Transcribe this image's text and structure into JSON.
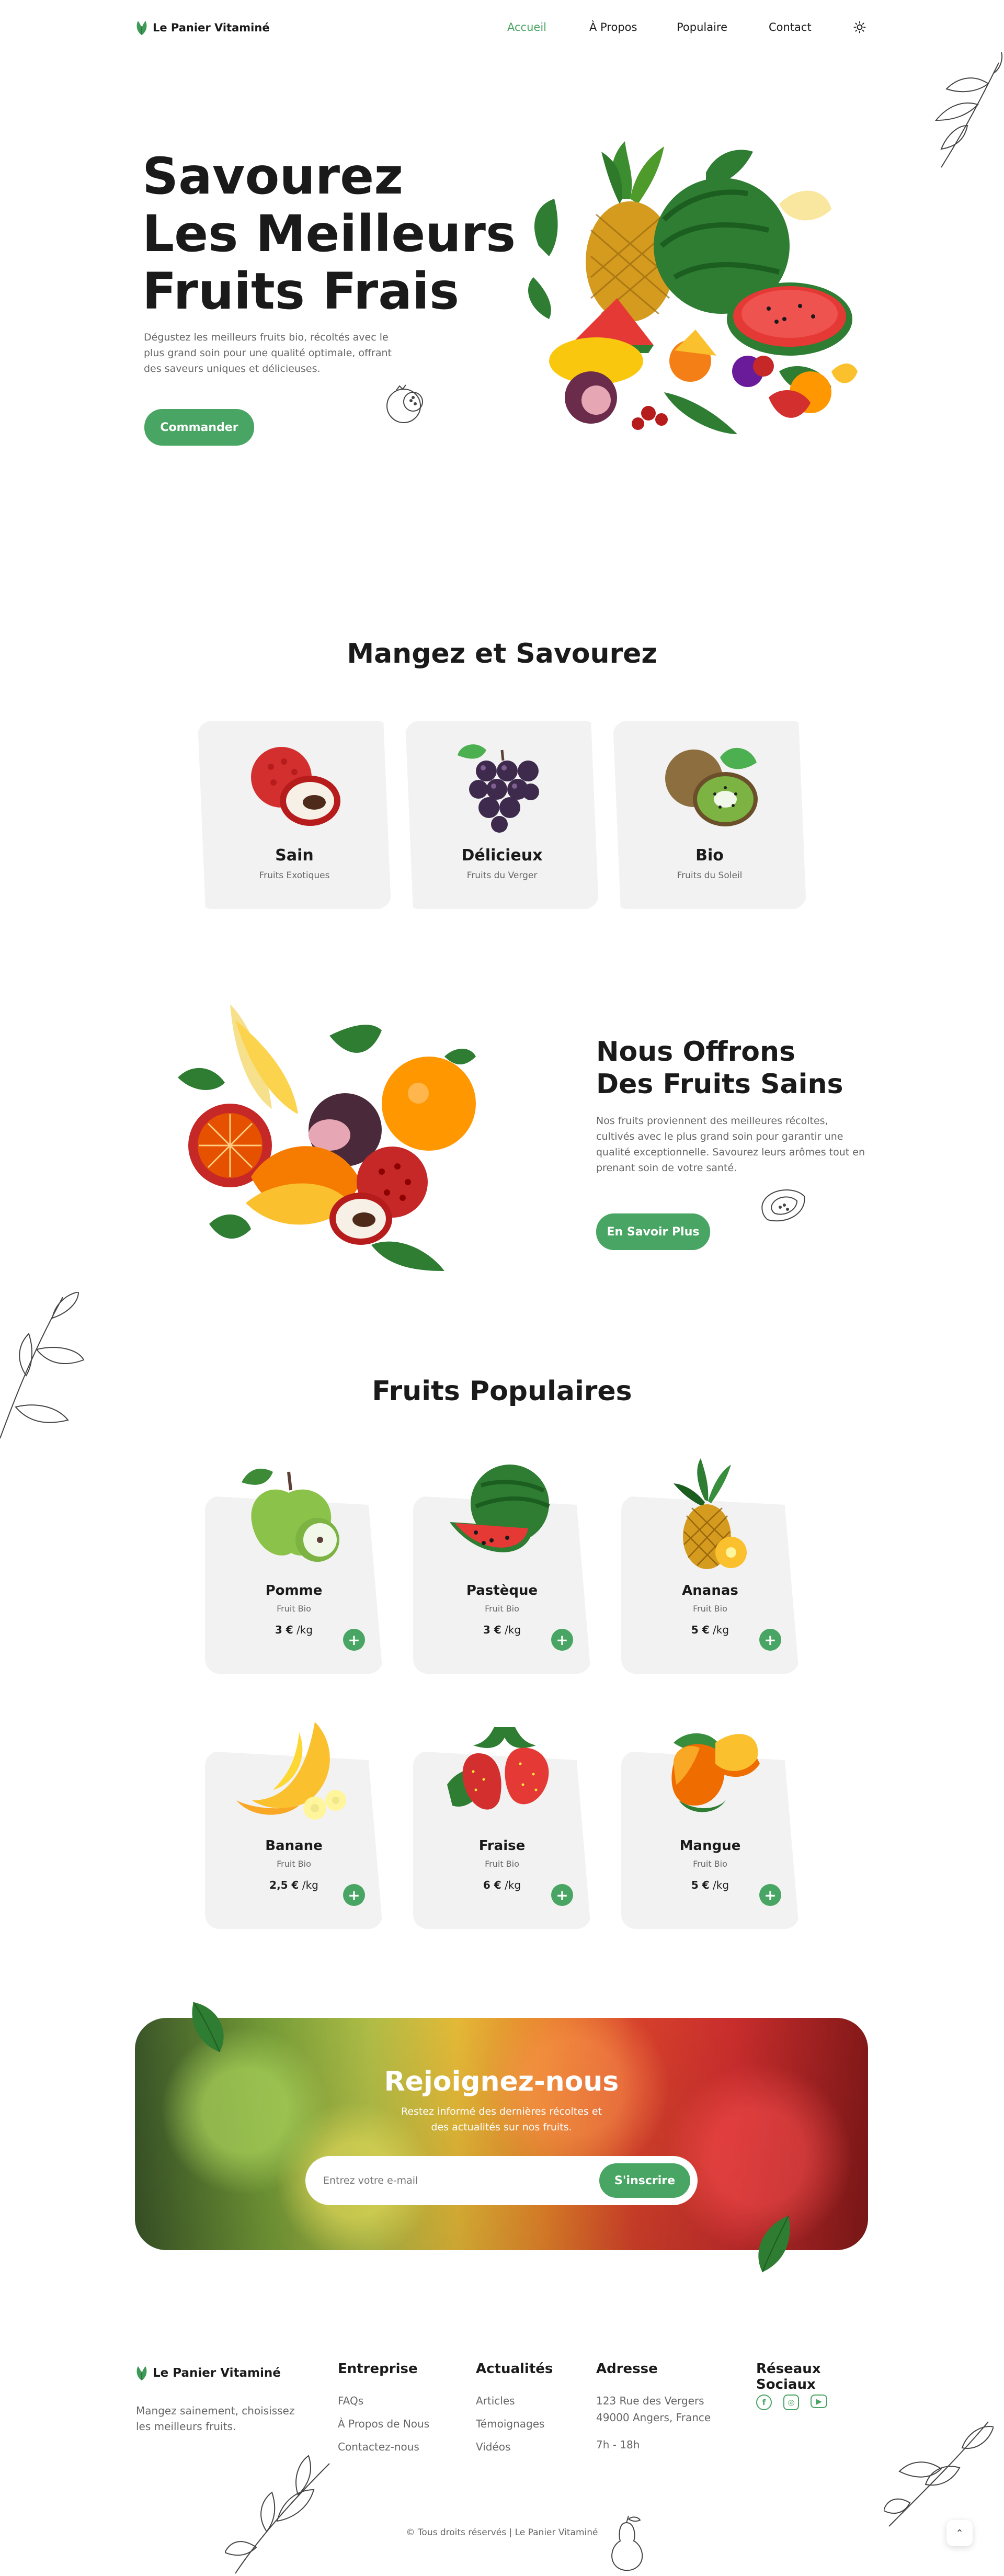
{
  "brand": {
    "name": "Le Panier Vitaminé"
  },
  "nav": {
    "items": [
      {
        "label": "Accueil",
        "active": true
      },
      {
        "label": "À Propos",
        "active": false
      },
      {
        "label": "Populaire",
        "active": false
      },
      {
        "label": "Contact",
        "active": false
      }
    ],
    "theme_icon": "sun-icon"
  },
  "hero": {
    "title_line1": "Savourez",
    "title_line2": "Les Meilleurs",
    "title_line3": "Fruits Frais",
    "description": "Dégustez les meilleurs fruits bio, récoltés avec le plus grand soin pour une qualité optimale, offrant des saveurs uniques et délicieuses.",
    "cta": "Commander"
  },
  "eat": {
    "title": "Mangez et Savourez",
    "cards": [
      {
        "title": "Sain",
        "subtitle": "Fruits Exotiques",
        "icon": "lychee-icon"
      },
      {
        "title": "Délicieux",
        "subtitle": "Fruits du Verger",
        "icon": "grapes-icon"
      },
      {
        "title": "Bio",
        "subtitle": "Fruits du Soleil",
        "icon": "kiwi-icon"
      }
    ]
  },
  "offer": {
    "title_line1": "Nous Offrons",
    "title_line2": "Des Fruits Sains",
    "description": "Nos fruits proviennent des meilleures récoltes, cultivés avec le plus grand soin pour garantir une qualité exceptionnelle. Savourez leurs arômes tout en prenant soin de votre santé.",
    "cta": "En Savoir Plus"
  },
  "popular": {
    "title": "Fruits Populaires",
    "items": [
      {
        "name": "Pomme",
        "type": "Fruit Bio",
        "price": "3 €",
        "unit": "/kg",
        "icon": "apple-icon"
      },
      {
        "name": "Pastèque",
        "type": "Fruit Bio",
        "price": "3 €",
        "unit": "/kg",
        "icon": "watermelon-icon"
      },
      {
        "name": "Ananas",
        "type": "Fruit Bio",
        "price": "5 €",
        "unit": "/kg",
        "icon": "pineapple-icon"
      },
      {
        "name": "Banane",
        "type": "Fruit Bio",
        "price": "2,5 €",
        "unit": "/kg",
        "icon": "banana-icon"
      },
      {
        "name": "Fraise",
        "type": "Fruit Bio",
        "price": "6 €",
        "unit": "/kg",
        "icon": "strawberry-icon"
      },
      {
        "name": "Mangue",
        "type": "Fruit Bio",
        "price": "5 €",
        "unit": "/kg",
        "icon": "mango-icon"
      }
    ],
    "add_icon": "plus-icon"
  },
  "newsletter": {
    "title": "Rejoignez-nous",
    "description": "Restez informé des dernières récoltes et des actualités sur nos fruits.",
    "placeholder": "Entrez votre e-mail",
    "cta": "S'inscrire"
  },
  "footer": {
    "brand": "Le Panier Vitaminé",
    "tagline": "Mangez sainement, choisissez les meilleurs fruits.",
    "columns": [
      {
        "title": "Entreprise",
        "links": [
          "FAQs",
          "À Propos de Nous",
          "Contactez-nous"
        ]
      },
      {
        "title": "Actualités",
        "links": [
          "Articles",
          "Témoignages",
          "Vidéos"
        ]
      },
      {
        "title": "Adresse",
        "links": [
          "123 Rue des Vergers",
          "49000 Angers, France",
          "7h - 18h"
        ]
      }
    ],
    "social_title": "Réseaux Sociaux",
    "social_icons": [
      "facebook-icon",
      "instagram-icon",
      "youtube-icon"
    ],
    "copyright": "© Tous droits réservés | Le Panier Vitaminé"
  },
  "colors": {
    "accent": "#49a563",
    "card": "#f2f2f2",
    "text": "#1a1a1a"
  }
}
